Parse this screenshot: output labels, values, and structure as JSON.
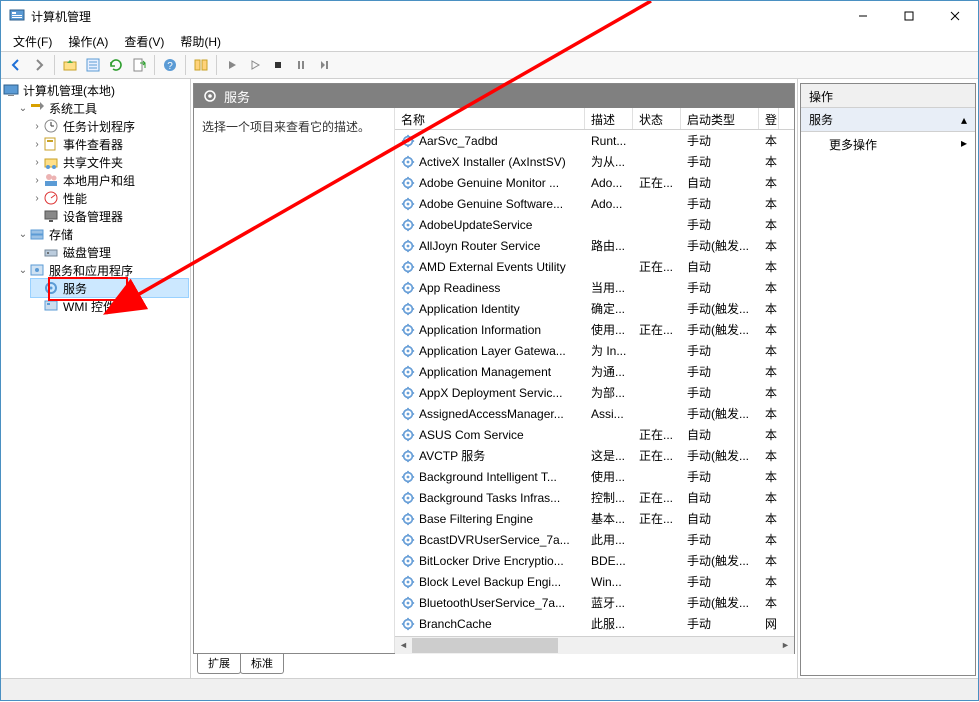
{
  "window": {
    "title": "计算机管理"
  },
  "menubar": {
    "file": "文件(F)",
    "action": "操作(A)",
    "view": "查看(V)",
    "help": "帮助(H)"
  },
  "tree": {
    "root": "计算机管理(本地)",
    "system_tools": "系统工具",
    "task_scheduler": "任务计划程序",
    "event_viewer": "事件查看器",
    "shared_folders": "共享文件夹",
    "local_users": "本地用户和组",
    "performance": "性能",
    "device_manager": "设备管理器",
    "storage": "存储",
    "disk_mgmt": "磁盘管理",
    "services_apps": "服务和应用程序",
    "services": "服务",
    "wmi": "WMI 控件"
  },
  "services_pane": {
    "title": "服务",
    "prompt": "选择一个项目来查看它的描述。",
    "cols": {
      "name": "名称",
      "desc": "描述",
      "status": "状态",
      "start": "启动类型",
      "logon": "登"
    }
  },
  "rows": [
    {
      "name": "AarSvc_7adbd",
      "desc": "Runt...",
      "status": "",
      "start": "手动",
      "logon": "本"
    },
    {
      "name": "ActiveX Installer (AxInstSV)",
      "desc": "为从...",
      "status": "",
      "start": "手动",
      "logon": "本"
    },
    {
      "name": "Adobe Genuine Monitor ...",
      "desc": "Ado...",
      "status": "正在...",
      "start": "自动",
      "logon": "本"
    },
    {
      "name": "Adobe Genuine Software...",
      "desc": "Ado...",
      "status": "",
      "start": "手动",
      "logon": "本"
    },
    {
      "name": "AdobeUpdateService",
      "desc": "",
      "status": "",
      "start": "手动",
      "logon": "本"
    },
    {
      "name": "AllJoyn Router Service",
      "desc": "路由...",
      "status": "",
      "start": "手动(触发...",
      "logon": "本"
    },
    {
      "name": "AMD External Events Utility",
      "desc": "",
      "status": "正在...",
      "start": "自动",
      "logon": "本"
    },
    {
      "name": "App Readiness",
      "desc": "当用...",
      "status": "",
      "start": "手动",
      "logon": "本"
    },
    {
      "name": "Application Identity",
      "desc": "确定...",
      "status": "",
      "start": "手动(触发...",
      "logon": "本"
    },
    {
      "name": "Application Information",
      "desc": "使用...",
      "status": "正在...",
      "start": "手动(触发...",
      "logon": "本"
    },
    {
      "name": "Application Layer Gatewa...",
      "desc": "为 In...",
      "status": "",
      "start": "手动",
      "logon": "本"
    },
    {
      "name": "Application Management",
      "desc": "为通...",
      "status": "",
      "start": "手动",
      "logon": "本"
    },
    {
      "name": "AppX Deployment Servic...",
      "desc": "为部...",
      "status": "",
      "start": "手动",
      "logon": "本"
    },
    {
      "name": "AssignedAccessManager...",
      "desc": "Assi...",
      "status": "",
      "start": "手动(触发...",
      "logon": "本"
    },
    {
      "name": "ASUS Com Service",
      "desc": "",
      "status": "正在...",
      "start": "自动",
      "logon": "本"
    },
    {
      "name": "AVCTP 服务",
      "desc": "这是...",
      "status": "正在...",
      "start": "手动(触发...",
      "logon": "本"
    },
    {
      "name": "Background Intelligent T...",
      "desc": "使用...",
      "status": "",
      "start": "手动",
      "logon": "本"
    },
    {
      "name": "Background Tasks Infras...",
      "desc": "控制...",
      "status": "正在...",
      "start": "自动",
      "logon": "本"
    },
    {
      "name": "Base Filtering Engine",
      "desc": "基本...",
      "status": "正在...",
      "start": "自动",
      "logon": "本"
    },
    {
      "name": "BcastDVRUserService_7a...",
      "desc": "此用...",
      "status": "",
      "start": "手动",
      "logon": "本"
    },
    {
      "name": "BitLocker Drive Encryptio...",
      "desc": "BDE...",
      "status": "",
      "start": "手动(触发...",
      "logon": "本"
    },
    {
      "name": "Block Level Backup Engi...",
      "desc": "Win...",
      "status": "",
      "start": "手动",
      "logon": "本"
    },
    {
      "name": "BluetoothUserService_7a...",
      "desc": "蓝牙...",
      "status": "",
      "start": "手动(触发...",
      "logon": "本"
    },
    {
      "name": "BranchCache",
      "desc": "此服...",
      "status": "",
      "start": "手动",
      "logon": "网"
    }
  ],
  "tabs": {
    "extended": "扩展",
    "standard": "标准"
  },
  "actions": {
    "header": "操作",
    "sub": "服务",
    "more": "更多操作"
  }
}
